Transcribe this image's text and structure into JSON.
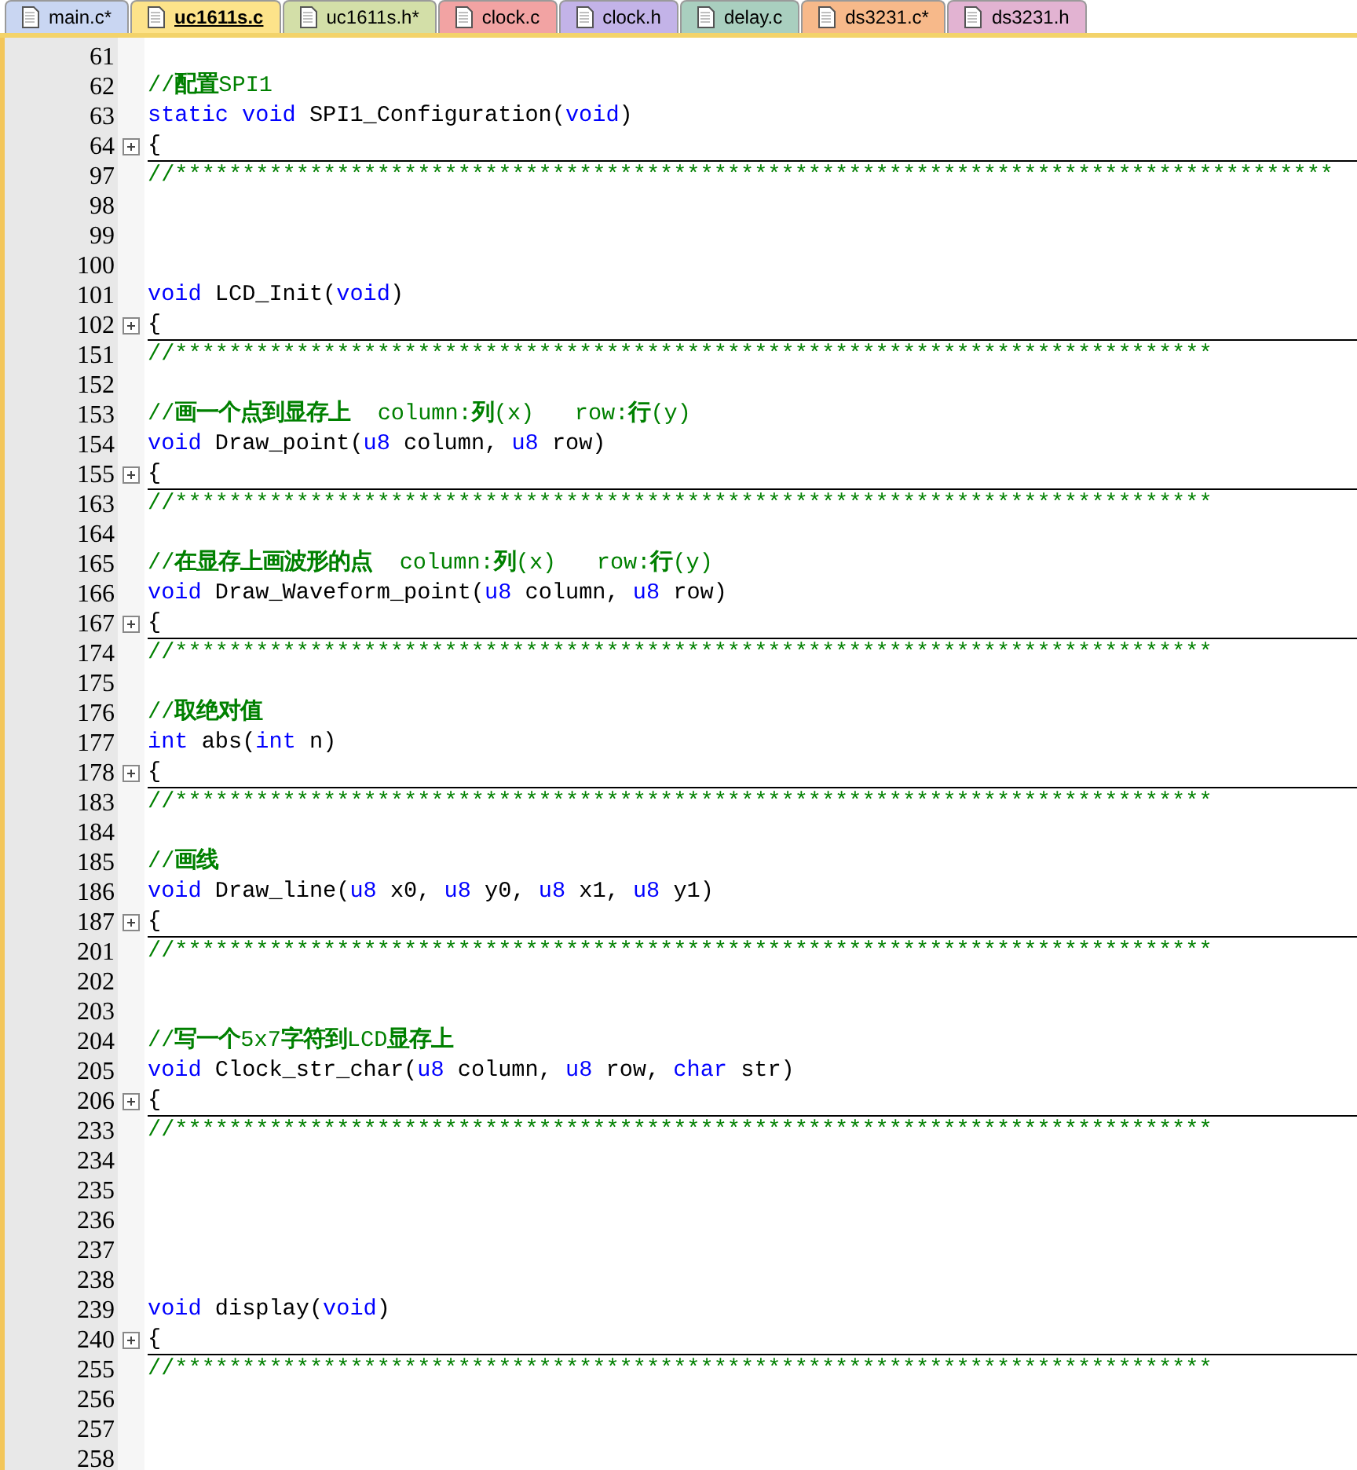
{
  "tabs": [
    {
      "label": "main.c*",
      "selected": false,
      "color": "#c9d6f2"
    },
    {
      "label": "uc1611s.c",
      "selected": true,
      "color": "#fde38a"
    },
    {
      "label": "uc1611s.h*",
      "selected": false,
      "color": "#d3dfa8"
    },
    {
      "label": "clock.c",
      "selected": false,
      "color": "#f2a3a3"
    },
    {
      "label": "clock.h",
      "selected": false,
      "color": "#c3b3e8"
    },
    {
      "label": "delay.c",
      "selected": false,
      "color": "#a9cfbf"
    },
    {
      "label": "ds3231.c*",
      "selected": false,
      "color": "#f7b98a"
    },
    {
      "label": "ds3231.h",
      "selected": false,
      "color": "#e2b3d2"
    }
  ],
  "lines": [
    {
      "number": "61",
      "folded": false
    },
    {
      "number": "62",
      "folded": false,
      "tokens": [
        {
          "kind": "comment",
          "text": "//"
        },
        {
          "kind": "comment_bold",
          "text": "配置"
        },
        {
          "kind": "comment",
          "text": "SPI1"
        }
      ]
    },
    {
      "number": "63",
      "folded": false,
      "tokens": [
        {
          "kind": "keyword",
          "text": "static void"
        },
        {
          "kind": "plain",
          "text": " SPI1_Configuration("
        },
        {
          "kind": "keyword",
          "text": "void"
        },
        {
          "kind": "plain",
          "text": ")"
        }
      ]
    },
    {
      "number": "64",
      "folded": true,
      "tokens": [
        {
          "kind": "plain",
          "text": "{"
        }
      ]
    },
    {
      "number": "97",
      "folded": false,
      "tokens": [
        {
          "kind": "comment",
          "text": "//**************************************************************************************"
        }
      ]
    },
    {
      "number": "98",
      "folded": false
    },
    {
      "number": "99",
      "folded": false
    },
    {
      "number": "100",
      "folded": false
    },
    {
      "number": "101",
      "folded": false,
      "tokens": [
        {
          "kind": "keyword",
          "text": "void"
        },
        {
          "kind": "plain",
          "text": " LCD_Init("
        },
        {
          "kind": "keyword",
          "text": "void"
        },
        {
          "kind": "plain",
          "text": ")"
        }
      ]
    },
    {
      "number": "102",
      "folded": true,
      "tokens": [
        {
          "kind": "plain",
          "text": "{"
        }
      ]
    },
    {
      "number": "151",
      "folded": false,
      "tokens": [
        {
          "kind": "comment",
          "text": "//*****************************************************************************"
        }
      ]
    },
    {
      "number": "152",
      "folded": false
    },
    {
      "number": "153",
      "folded": false,
      "tokens": [
        {
          "kind": "comment",
          "text": "//"
        },
        {
          "kind": "comment_bold",
          "text": "画一个点到显存上"
        },
        {
          "kind": "comment",
          "text": "  column:"
        },
        {
          "kind": "comment_bold",
          "text": "列"
        },
        {
          "kind": "comment",
          "text": "(x)   row:"
        },
        {
          "kind": "comment_bold",
          "text": "行"
        },
        {
          "kind": "comment",
          "text": "(y)"
        }
      ]
    },
    {
      "number": "154",
      "folded": false,
      "tokens": [
        {
          "kind": "keyword",
          "text": "void"
        },
        {
          "kind": "plain",
          "text": " Draw_point("
        },
        {
          "kind": "keyword",
          "text": "u8"
        },
        {
          "kind": "plain",
          "text": " column, "
        },
        {
          "kind": "keyword",
          "text": "u8"
        },
        {
          "kind": "plain",
          "text": " row)"
        }
      ]
    },
    {
      "number": "155",
      "folded": true,
      "tokens": [
        {
          "kind": "plain",
          "text": "{"
        }
      ]
    },
    {
      "number": "163",
      "folded": false,
      "tokens": [
        {
          "kind": "comment",
          "text": "//*****************************************************************************"
        }
      ]
    },
    {
      "number": "164",
      "folded": false
    },
    {
      "number": "165",
      "folded": false,
      "tokens": [
        {
          "kind": "comment",
          "text": "//"
        },
        {
          "kind": "comment_bold",
          "text": "在显存上画波形的点"
        },
        {
          "kind": "comment",
          "text": "  column:"
        },
        {
          "kind": "comment_bold",
          "text": "列"
        },
        {
          "kind": "comment",
          "text": "(x)   row:"
        },
        {
          "kind": "comment_bold",
          "text": "行"
        },
        {
          "kind": "comment",
          "text": "(y)"
        }
      ]
    },
    {
      "number": "166",
      "folded": false,
      "tokens": [
        {
          "kind": "keyword",
          "text": "void"
        },
        {
          "kind": "plain",
          "text": " Draw_Waveform_point("
        },
        {
          "kind": "keyword",
          "text": "u8"
        },
        {
          "kind": "plain",
          "text": " column, "
        },
        {
          "kind": "keyword",
          "text": "u8"
        },
        {
          "kind": "plain",
          "text": " row)"
        }
      ]
    },
    {
      "number": "167",
      "folded": true,
      "tokens": [
        {
          "kind": "plain",
          "text": "{"
        }
      ]
    },
    {
      "number": "174",
      "folded": false,
      "tokens": [
        {
          "kind": "comment",
          "text": "//*****************************************************************************"
        }
      ]
    },
    {
      "number": "175",
      "folded": false
    },
    {
      "number": "176",
      "folded": false,
      "tokens": [
        {
          "kind": "comment",
          "text": "//"
        },
        {
          "kind": "comment_bold",
          "text": "取绝对值"
        }
      ]
    },
    {
      "number": "177",
      "folded": false,
      "tokens": [
        {
          "kind": "keyword",
          "text": "int"
        },
        {
          "kind": "plain",
          "text": " abs("
        },
        {
          "kind": "keyword",
          "text": "int"
        },
        {
          "kind": "plain",
          "text": " n)"
        }
      ]
    },
    {
      "number": "178",
      "folded": true,
      "tokens": [
        {
          "kind": "plain",
          "text": "{"
        }
      ]
    },
    {
      "number": "183",
      "folded": false,
      "tokens": [
        {
          "kind": "comment",
          "text": "//*****************************************************************************"
        }
      ]
    },
    {
      "number": "184",
      "folded": false
    },
    {
      "number": "185",
      "folded": false,
      "tokens": [
        {
          "kind": "comment",
          "text": "//"
        },
        {
          "kind": "comment_bold",
          "text": "画线"
        }
      ]
    },
    {
      "number": "186",
      "folded": false,
      "tokens": [
        {
          "kind": "keyword",
          "text": "void"
        },
        {
          "kind": "plain",
          "text": " Draw_line("
        },
        {
          "kind": "keyword",
          "text": "u8"
        },
        {
          "kind": "plain",
          "text": " x0, "
        },
        {
          "kind": "keyword",
          "text": "u8"
        },
        {
          "kind": "plain",
          "text": " y0, "
        },
        {
          "kind": "keyword",
          "text": "u8"
        },
        {
          "kind": "plain",
          "text": " x1, "
        },
        {
          "kind": "keyword",
          "text": "u8"
        },
        {
          "kind": "plain",
          "text": " y1)"
        }
      ]
    },
    {
      "number": "187",
      "folded": true,
      "tokens": [
        {
          "kind": "plain",
          "text": "{"
        }
      ]
    },
    {
      "number": "201",
      "folded": false,
      "tokens": [
        {
          "kind": "comment",
          "text": "//*****************************************************************************"
        }
      ]
    },
    {
      "number": "202",
      "folded": false
    },
    {
      "number": "203",
      "folded": false
    },
    {
      "number": "204",
      "folded": false,
      "tokens": [
        {
          "kind": "comment",
          "text": "//"
        },
        {
          "kind": "comment_bold",
          "text": "写一个"
        },
        {
          "kind": "comment",
          "text": "5x7"
        },
        {
          "kind": "comment_bold",
          "text": "字符到"
        },
        {
          "kind": "comment",
          "text": "LCD"
        },
        {
          "kind": "comment_bold",
          "text": "显存上"
        }
      ]
    },
    {
      "number": "205",
      "folded": false,
      "tokens": [
        {
          "kind": "keyword",
          "text": "void"
        },
        {
          "kind": "plain",
          "text": " Clock_str_char("
        },
        {
          "kind": "keyword",
          "text": "u8"
        },
        {
          "kind": "plain",
          "text": " column, "
        },
        {
          "kind": "keyword",
          "text": "u8"
        },
        {
          "kind": "plain",
          "text": " row, "
        },
        {
          "kind": "keyword",
          "text": "char"
        },
        {
          "kind": "plain",
          "text": " str)"
        }
      ]
    },
    {
      "number": "206",
      "folded": true,
      "tokens": [
        {
          "kind": "plain",
          "text": "{"
        }
      ]
    },
    {
      "number": "233",
      "folded": false,
      "tokens": [
        {
          "kind": "comment",
          "text": "//*****************************************************************************"
        }
      ]
    },
    {
      "number": "234",
      "folded": false
    },
    {
      "number": "235",
      "folded": false
    },
    {
      "number": "236",
      "folded": false
    },
    {
      "number": "237",
      "folded": false
    },
    {
      "number": "238",
      "folded": false
    },
    {
      "number": "239",
      "folded": false,
      "tokens": [
        {
          "kind": "keyword",
          "text": "void"
        },
        {
          "kind": "plain",
          "text": " display("
        },
        {
          "kind": "keyword",
          "text": "void"
        },
        {
          "kind": "plain",
          "text": ")"
        }
      ]
    },
    {
      "number": "240",
      "folded": true,
      "tokens": [
        {
          "kind": "plain",
          "text": "{"
        }
      ]
    },
    {
      "number": "255",
      "folded": false,
      "tokens": [
        {
          "kind": "comment",
          "text": "//*****************************************************************************"
        }
      ]
    },
    {
      "number": "256",
      "folded": false
    },
    {
      "number": "257",
      "folded": false
    },
    {
      "number": "258",
      "folded": false
    }
  ]
}
